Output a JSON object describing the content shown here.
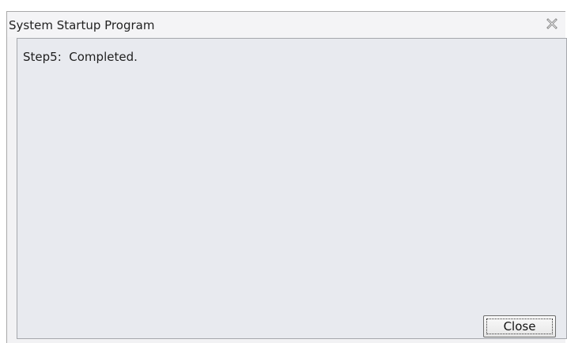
{
  "window": {
    "title": "System Startup Program",
    "close_icon": "close-x-icon"
  },
  "content": {
    "status_text": "Step5:  Completed."
  },
  "footer": {
    "close_label": "Close"
  }
}
